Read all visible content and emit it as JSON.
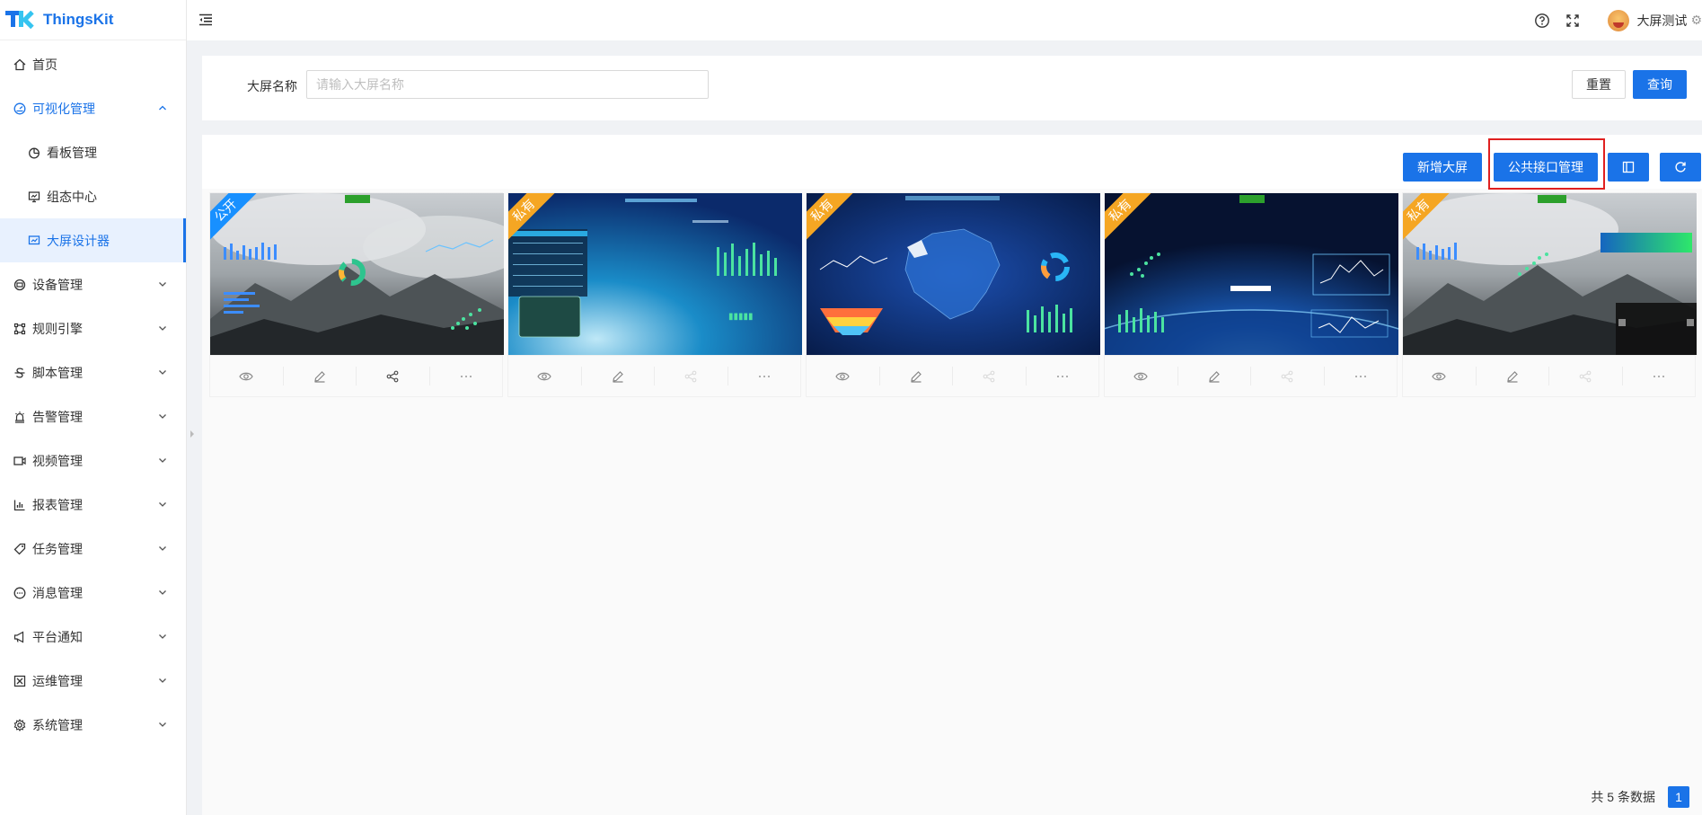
{
  "app": {
    "name": "ThingsKit"
  },
  "colors": {
    "primary": "#1a73e8",
    "public_ribbon": "#1890ff",
    "private_ribbon": "#f5a623",
    "highlight": "#e02020"
  },
  "sidebar": {
    "items": [
      {
        "label": "首页",
        "icon": "home-icon"
      },
      {
        "label": "可视化管理",
        "icon": "dashboard-icon",
        "expanded": true,
        "children": [
          {
            "label": "看板管理",
            "icon": "pie-chart-icon"
          },
          {
            "label": "组态中心",
            "icon": "monitor-icon"
          },
          {
            "label": "大屏设计器",
            "icon": "screen-design-icon",
            "active": true
          }
        ]
      },
      {
        "label": "设备管理",
        "icon": "device-icon"
      },
      {
        "label": "规则引擎",
        "icon": "rule-engine-icon"
      },
      {
        "label": "脚本管理",
        "icon": "script-icon"
      },
      {
        "label": "告警管理",
        "icon": "alarm-icon"
      },
      {
        "label": "视频管理",
        "icon": "video-icon"
      },
      {
        "label": "报表管理",
        "icon": "report-icon"
      },
      {
        "label": "任务管理",
        "icon": "task-icon"
      },
      {
        "label": "消息管理",
        "icon": "message-icon"
      },
      {
        "label": "平台通知",
        "icon": "notice-icon"
      },
      {
        "label": "运维管理",
        "icon": "ops-icon"
      },
      {
        "label": "系统管理",
        "icon": "settings-icon"
      }
    ]
  },
  "header": {
    "user_name": "大屏测试"
  },
  "search": {
    "label": "大屏名称",
    "placeholder": "请输入大屏名称",
    "value": "",
    "reset_label": "重置",
    "query_label": "查询"
  },
  "toolbar": {
    "new_label": "新增大屏",
    "public_api_label": "公共接口管理"
  },
  "cards": [
    {
      "ribbon": "公开",
      "ribbon_type": "public",
      "theme": "mountain",
      "share_enabled": true
    },
    {
      "ribbon": "私有",
      "ribbon_type": "private",
      "theme": "blue-gradient",
      "share_enabled": false
    },
    {
      "ribbon": "私有",
      "ribbon_type": "private",
      "theme": "china-map",
      "share_enabled": false
    },
    {
      "ribbon": "私有",
      "ribbon_type": "private",
      "theme": "earth",
      "share_enabled": false
    },
    {
      "ribbon": "私有",
      "ribbon_type": "private",
      "theme": "mountain-2",
      "share_enabled": false
    }
  ],
  "pagination": {
    "total_text": "共 5 条数据",
    "current_page": "1"
  }
}
